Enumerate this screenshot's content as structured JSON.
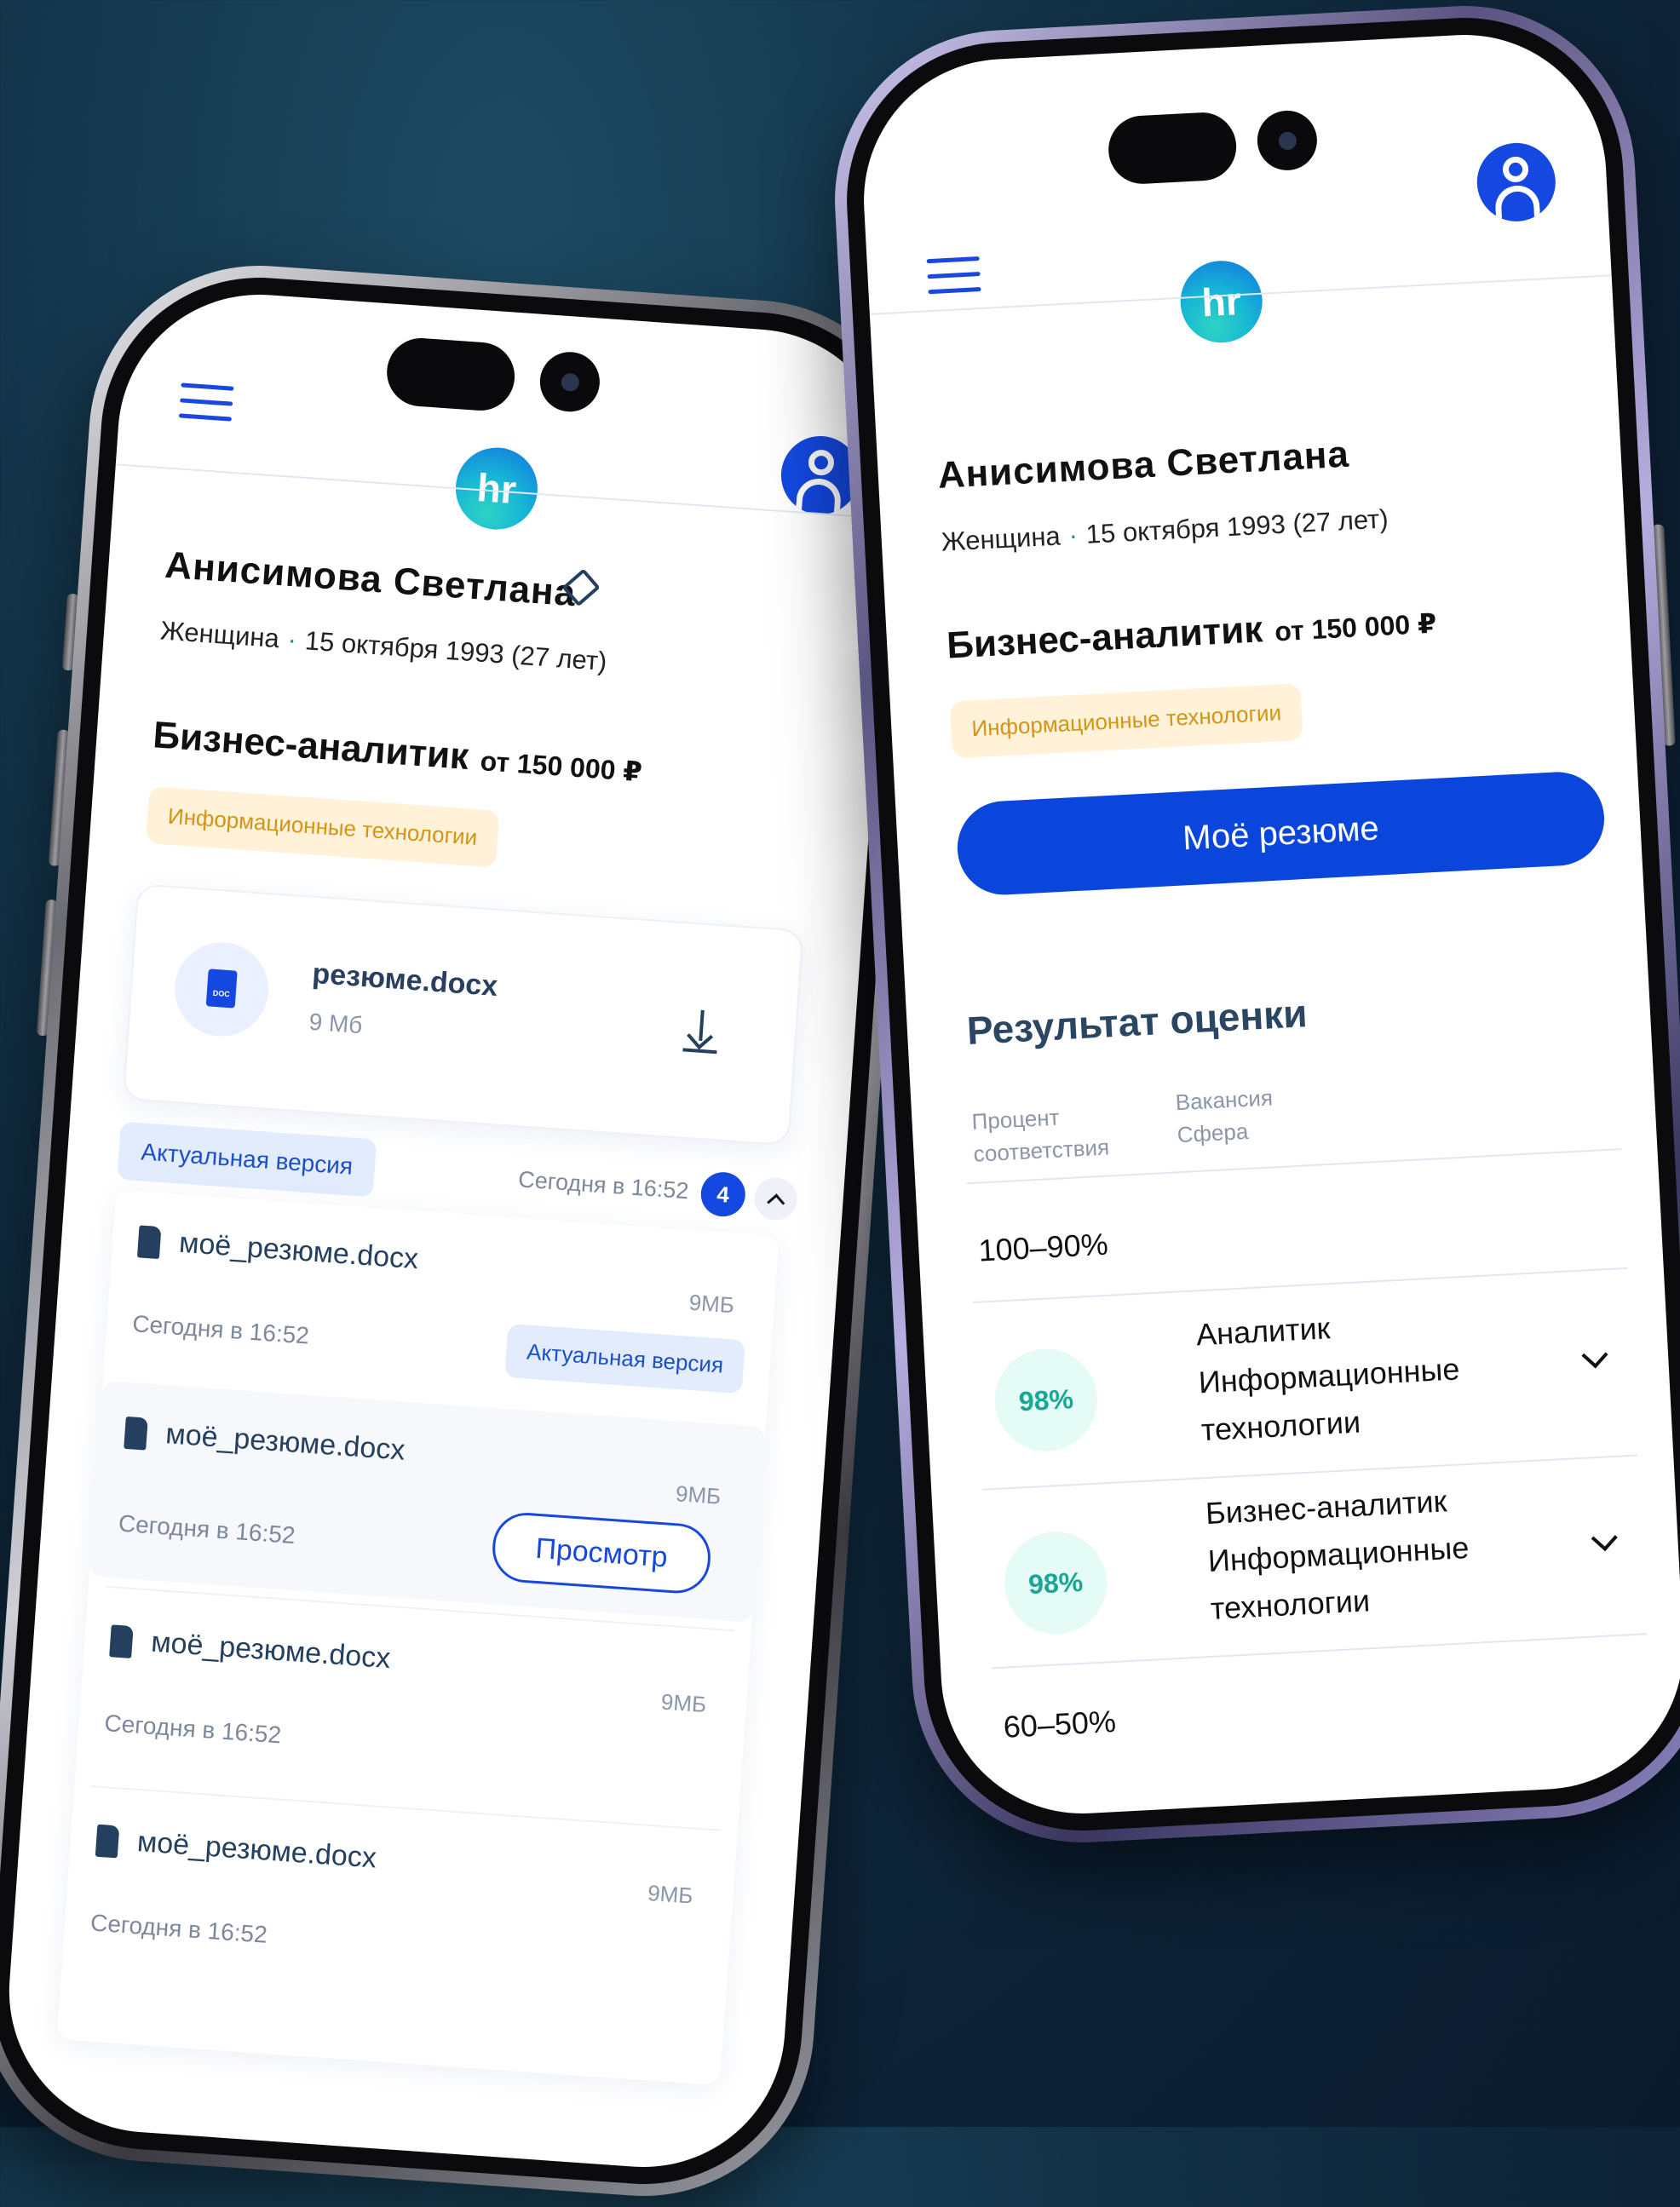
{
  "profile": {
    "name": "Анисимова Светлана",
    "gender": "Женщина",
    "separator": "·",
    "birth": "15 октября 1993 (27 лет)",
    "position": "Бизнес-аналитик",
    "salary": "от 150 000 ₽",
    "sphere": "Информационные технологии",
    "logo_text": "hr"
  },
  "resume": {
    "file_name": "резюме.docx",
    "file_size": "9 Мб",
    "doc_label": "DOC",
    "current_version_label": "Актуальная версия",
    "timestamp": "Сегодня в 16:52",
    "versions_count": "4"
  },
  "versions": [
    {
      "name": "моё_резюме.docx",
      "size": "9МБ",
      "time": "Сегодня в 16:52",
      "action": "Актуальная версия"
    },
    {
      "name": "моё_резюме.docx",
      "size": "9МБ",
      "time": "Сегодня в 16:52",
      "action": "Просмотр"
    },
    {
      "name": "моё_резюме.docx",
      "size": "9МБ",
      "time": "Сегодня в 16:52"
    },
    {
      "name": "моё_резюме.docx",
      "size": "9МБ",
      "time": "Сегодня в 16:52"
    }
  ],
  "right": {
    "my_resume_button": "Моё резюме",
    "results_title": "Результат оценки",
    "col_match_1": "Процент",
    "col_match_2": "соответствия",
    "col_vac_1": "Вакансия",
    "col_vac_2": "Сфера",
    "range_1": "100–90%",
    "range_2": "60–50%",
    "results": [
      {
        "percent": "98%",
        "vacancy": "Аналитик",
        "sphere_1": "Информационные",
        "sphere_2": "технологии"
      },
      {
        "percent": "98%",
        "vacancy": "Бизнес-аналитик",
        "sphere_1": "Информационные",
        "sphere_2": "технологии"
      }
    ]
  },
  "icons": [
    "menu-icon",
    "logo-icon",
    "avatar-icon",
    "edit-icon",
    "doc-icon",
    "download-icon",
    "chevron-up-icon",
    "chevron-down-icon"
  ],
  "colors": {
    "accent": "#1448e0",
    "teal": "#1aa596",
    "tag_bg": "#fff2d8",
    "tag_text": "#d49414"
  }
}
